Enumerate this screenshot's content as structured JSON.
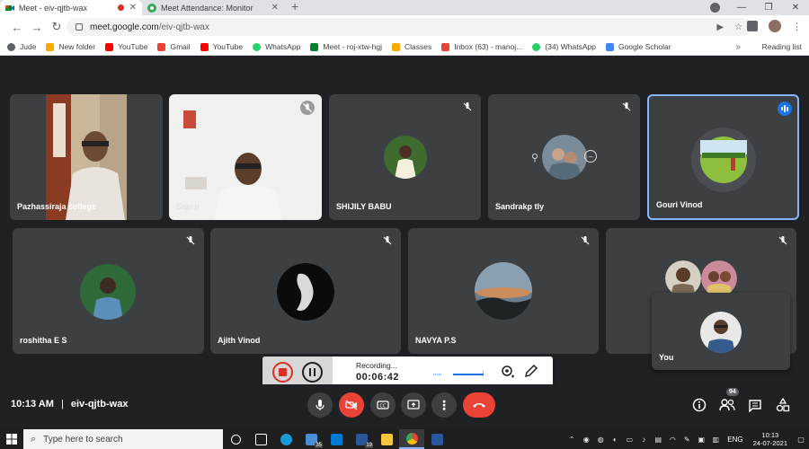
{
  "browser": {
    "tabs": [
      {
        "title": "Meet - eiv-qjtb-wax",
        "recording": true
      },
      {
        "title": "Meet Attendance: Monitor",
        "recording": false
      }
    ],
    "url_host": "meet.google.com",
    "url_path": "/eiv-qjtb-wax",
    "bookmarks": [
      "Jude",
      "New folder",
      "YouTube",
      "Gmail",
      "YouTube",
      "WhatsApp",
      "Meet - roj-xtw-hgj",
      "Classes",
      "Inbox (63) - manoj...",
      "(34) WhatsApp",
      "Google Scholar"
    ],
    "bookmarks_more": "»",
    "reading_list": "Reading list"
  },
  "participants": [
    {
      "name": "Pazhassiraja college",
      "muted": false,
      "speaking": false
    },
    {
      "name": "Saju p",
      "muted": true,
      "speaking": false
    },
    {
      "name": "SHIJILY BABU",
      "muted": true,
      "speaking": false
    },
    {
      "name": "Sandrakp tly",
      "muted": true,
      "speaking": false
    },
    {
      "name": "Gouri Vinod",
      "muted": false,
      "speaking": true
    },
    {
      "name": "roshitha E S",
      "muted": true,
      "speaking": false
    },
    {
      "name": "Ajith Vinod",
      "muted": true,
      "speaking": false
    },
    {
      "name": "NAVYA P.S",
      "muted": true,
      "speaking": false
    },
    {
      "name": "",
      "muted": true,
      "speaking": false
    },
    {
      "name": "You",
      "muted": false,
      "speaking": false
    }
  ],
  "recording": {
    "label": "Recording...",
    "elapsed": "00:06:42"
  },
  "meeting": {
    "time": "10:13 AM",
    "separator": "|",
    "code": "eiv-qjtb-wax",
    "participant_count": "94"
  },
  "taskbar": {
    "search_placeholder": "Type here to search",
    "badges": {
      "edge": "35",
      "calendar": "19"
    },
    "language": "ENG",
    "clock_time": "10:13",
    "clock_date": "24-07-2021"
  },
  "colors": {
    "meet_bg": "#202124",
    "tile_bg": "#3c4043",
    "end_call": "#ea4335",
    "speaking_border": "#8ab4f8"
  }
}
